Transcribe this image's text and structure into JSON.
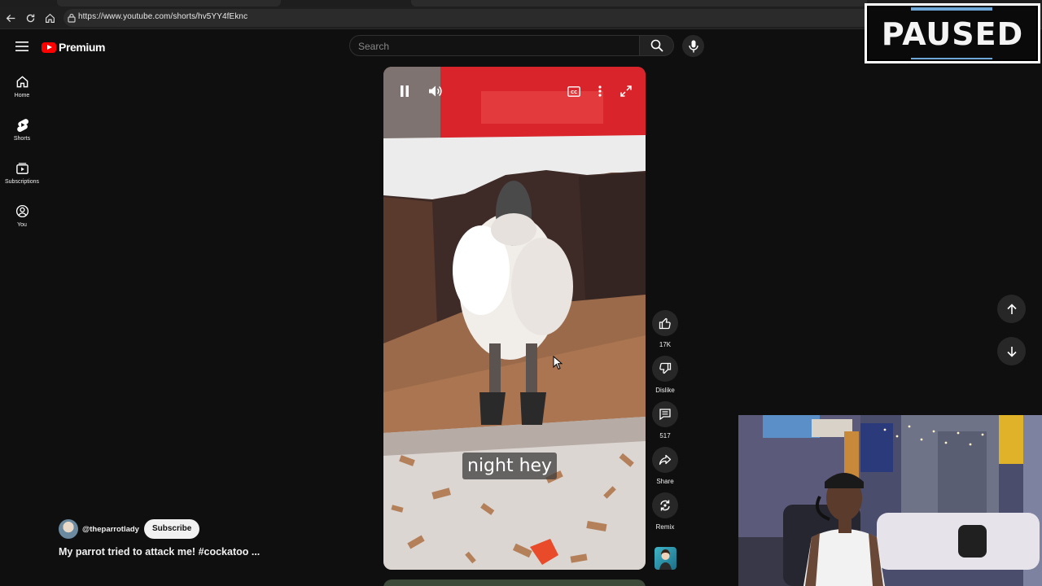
{
  "browser": {
    "url": "https://www.youtube.com/shorts/hv5YY4fEknc"
  },
  "header": {
    "logo_text": "Premium",
    "search_placeholder": "Search"
  },
  "sidebar": {
    "items": [
      {
        "label": "Home",
        "icon": "home-icon"
      },
      {
        "label": "Shorts",
        "icon": "shorts-icon"
      },
      {
        "label": "Subscriptions",
        "icon": "subscriptions-icon"
      },
      {
        "label": "You",
        "icon": "you-icon"
      }
    ]
  },
  "video": {
    "caption": "night hey"
  },
  "actions": {
    "like_count": "17K",
    "dislike_label": "Dislike",
    "comment_count": "517",
    "share_label": "Share",
    "remix_label": "Remix"
  },
  "channel": {
    "handle": "@theparrotlady",
    "subscribe_label": "Subscribe",
    "title": "My parrot tried to attack me! #cockatoo ..."
  },
  "overlay": {
    "paused_text": "PAUSED"
  },
  "colors": {
    "accent": "#ff0000",
    "background": "#0f0f0f"
  }
}
